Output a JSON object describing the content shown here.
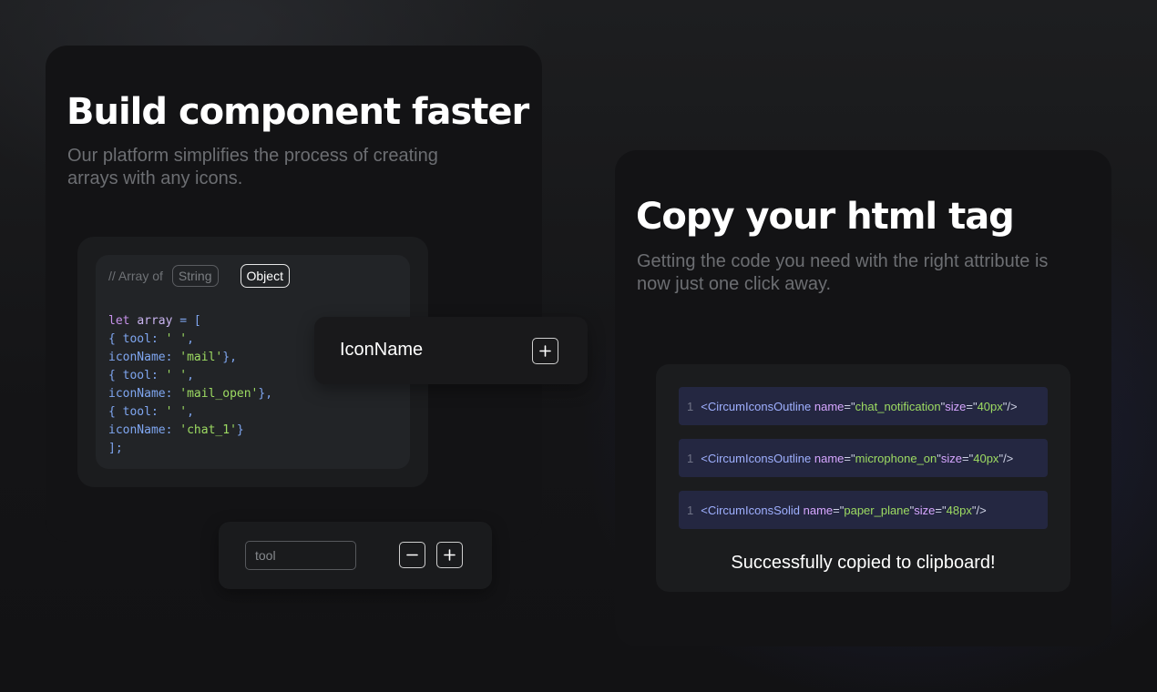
{
  "left_card": {
    "title": "Build component faster",
    "description": "Our platform simplifies the process of creating arrays with any icons.",
    "array_label": "// Array of",
    "type_options": [
      "String",
      "Object"
    ],
    "selected_type": "Object",
    "code_lines": [
      [
        {
          "t": "let ",
          "c": "kw"
        },
        {
          "t": "array",
          "c": "var"
        },
        {
          "t": " = [",
          "c": "punc"
        }
      ],
      [
        {
          "t": "{ tool: ",
          "c": "key"
        },
        {
          "t": "' '",
          "c": "str"
        },
        {
          "t": ",",
          "c": "punc"
        }
      ],
      [
        {
          "t": "iconName: ",
          "c": "key"
        },
        {
          "t": "'mail'",
          "c": "str"
        },
        {
          "t": "},",
          "c": "punc"
        }
      ],
      [
        {
          "t": "{ tool: ",
          "c": "key"
        },
        {
          "t": "' '",
          "c": "str"
        },
        {
          "t": ",",
          "c": "punc"
        }
      ],
      [
        {
          "t": "iconName: ",
          "c": "key"
        },
        {
          "t": "'mail_open'",
          "c": "str"
        },
        {
          "t": "},",
          "c": "punc"
        }
      ],
      [
        {
          "t": "{ tool: ",
          "c": "key"
        },
        {
          "t": "' '",
          "c": "str"
        },
        {
          "t": ",",
          "c": "punc"
        }
      ],
      [
        {
          "t": "iconName: ",
          "c": "key"
        },
        {
          "t": "'chat_1'",
          "c": "str"
        },
        {
          "t": "}",
          "c": "punc"
        }
      ],
      [
        {
          "t": "];",
          "c": "punc"
        }
      ]
    ]
  },
  "iconname_field": {
    "label": "IconName",
    "add_icon": "plus-icon"
  },
  "tool_field": {
    "placeholder": "tool",
    "value": "",
    "remove_icon": "minus-icon",
    "add_icon": "plus-icon"
  },
  "right_card": {
    "title": "Copy your html tag",
    "description": "Getting the code you need with the right attribute is now just one click away.",
    "tags": [
      {
        "line": "1",
        "component": "CircumIconsOutline",
        "name": "chat_notification",
        "size": "40px"
      },
      {
        "line": "1",
        "component": "CircumIconsOutline",
        "name": "microphone_on",
        "size": "40px"
      },
      {
        "line": "1",
        "component": "CircumIconsSolid",
        "name": "paper_plane",
        "size": "48px"
      }
    ],
    "tag_tokens": {
      "open": "<",
      "name_attr": "name",
      "size_attr": "size",
      "eq": "=",
      "quote": "\"",
      "close": "/>"
    },
    "copied_message": "Successfully copied to clipboard!"
  },
  "colors": {
    "card_background": "#131315",
    "code_background": "#222427",
    "tag_row_background": "#242741",
    "muted_text": "#6c6e72",
    "code_keyword": "#c792ea",
    "code_key": "#7fa6f0",
    "code_string": "#9ddb62",
    "tag_component": "#9fb0ff",
    "tag_attribute": "#d6a6ff"
  }
}
